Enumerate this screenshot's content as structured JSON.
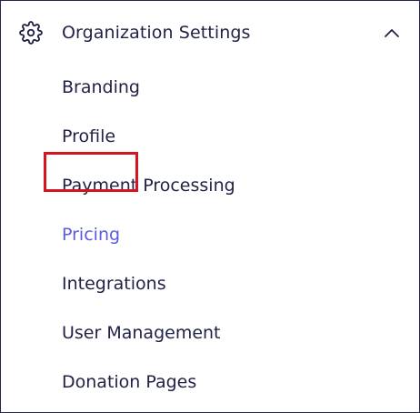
{
  "section": {
    "title": "Organization Settings",
    "icon": "gear-icon",
    "toggle_icon": "chevron-up-icon",
    "expanded": true
  },
  "menu": {
    "items": [
      {
        "label": "Branding"
      },
      {
        "label": "Profile"
      },
      {
        "label": "Payment Processing"
      },
      {
        "label": "Pricing",
        "active": true
      },
      {
        "label": "Integrations"
      },
      {
        "label": "User Management"
      },
      {
        "label": "Donation Pages"
      }
    ]
  },
  "colors": {
    "text": "#1f2145",
    "active": "#5b5be0",
    "highlight_border": "#d4141e",
    "frame_border": "#25254a"
  }
}
